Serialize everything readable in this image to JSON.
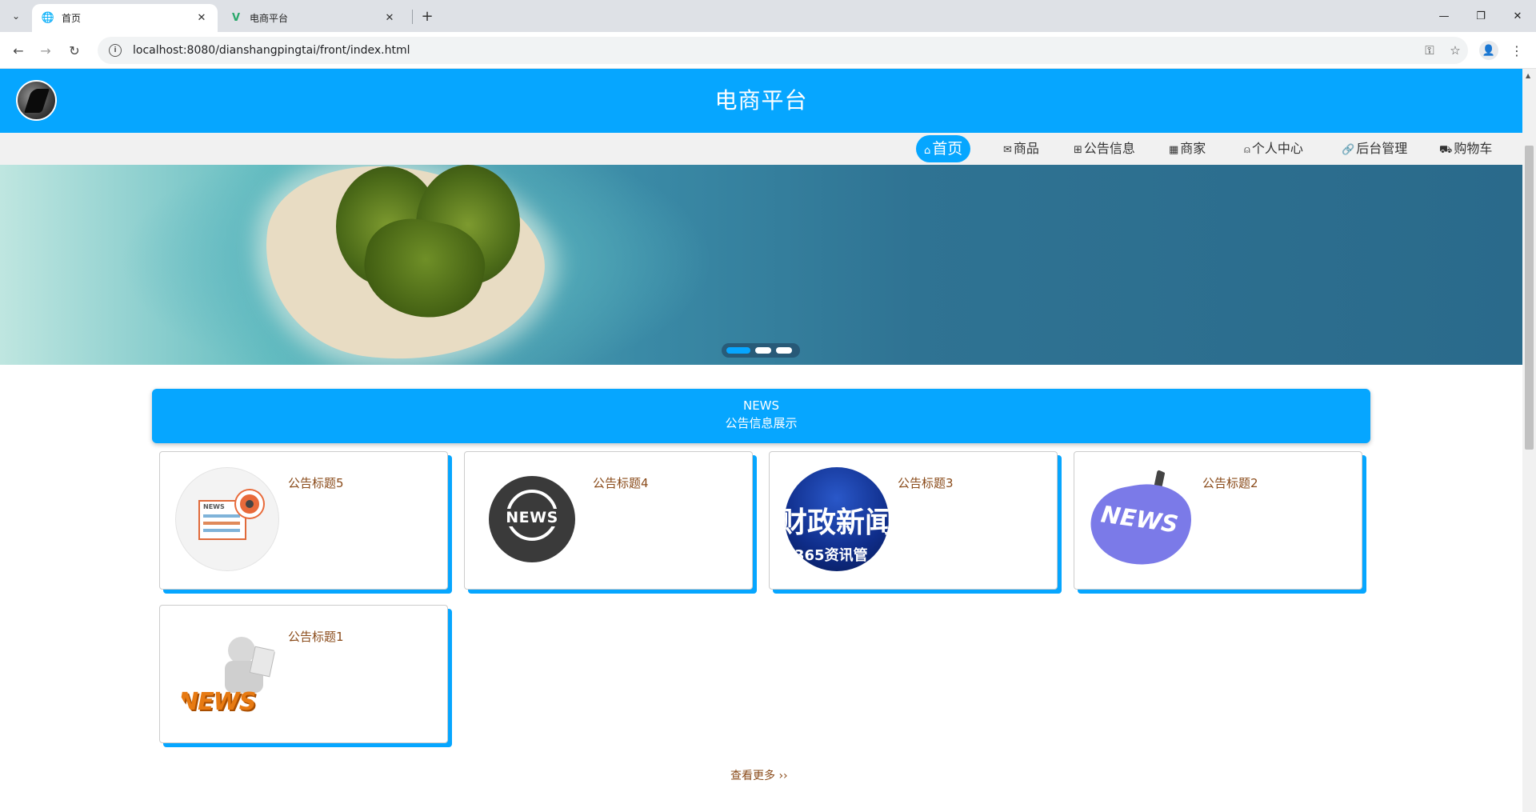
{
  "browser": {
    "tabs": [
      {
        "title": "首页",
        "favicon": "globe-icon",
        "active": true
      },
      {
        "title": "电商平台",
        "favicon": "vue-icon",
        "active": false
      }
    ],
    "url": "localhost:8080/dianshangpingtai/front/index.html"
  },
  "site": {
    "title": "电商平台",
    "nav": [
      {
        "label": "首页",
        "icon": "home-icon",
        "active": true
      },
      {
        "label": "商品",
        "icon": "mail-icon",
        "active": false
      },
      {
        "label": "公告信息",
        "icon": "gift-icon",
        "active": false
      },
      {
        "label": "商家",
        "icon": "calendar-icon",
        "active": false
      },
      {
        "label": "个人中心",
        "icon": "user-icon",
        "active": false
      },
      {
        "label": "后台管理",
        "icon": "link-icon",
        "active": false
      },
      {
        "label": "购物车",
        "icon": "cart-icon",
        "active": false
      }
    ]
  },
  "carousel": {
    "slide_count": 3,
    "active_index": 0
  },
  "news": {
    "heading_en": "NEWS",
    "heading_cn": "公告信息展示",
    "items": [
      {
        "title": "公告标题5"
      },
      {
        "title": "公告标题4"
      },
      {
        "title": "公告标题3"
      },
      {
        "title": "公告标题2"
      },
      {
        "title": "公告标题1"
      }
    ],
    "more_label": "查看更多"
  },
  "thumbs": {
    "t5_label": "NEWS",
    "t4_label": "NEWS",
    "t3_big": "财政新闻",
    "t3_small": "365资讯管",
    "t2_label": "NEWS",
    "t1_label": "NEWS"
  },
  "colors": {
    "accent": "#06a6ff",
    "title_text": "#8a4b1a",
    "nav_bg": "#f1f1f1"
  }
}
